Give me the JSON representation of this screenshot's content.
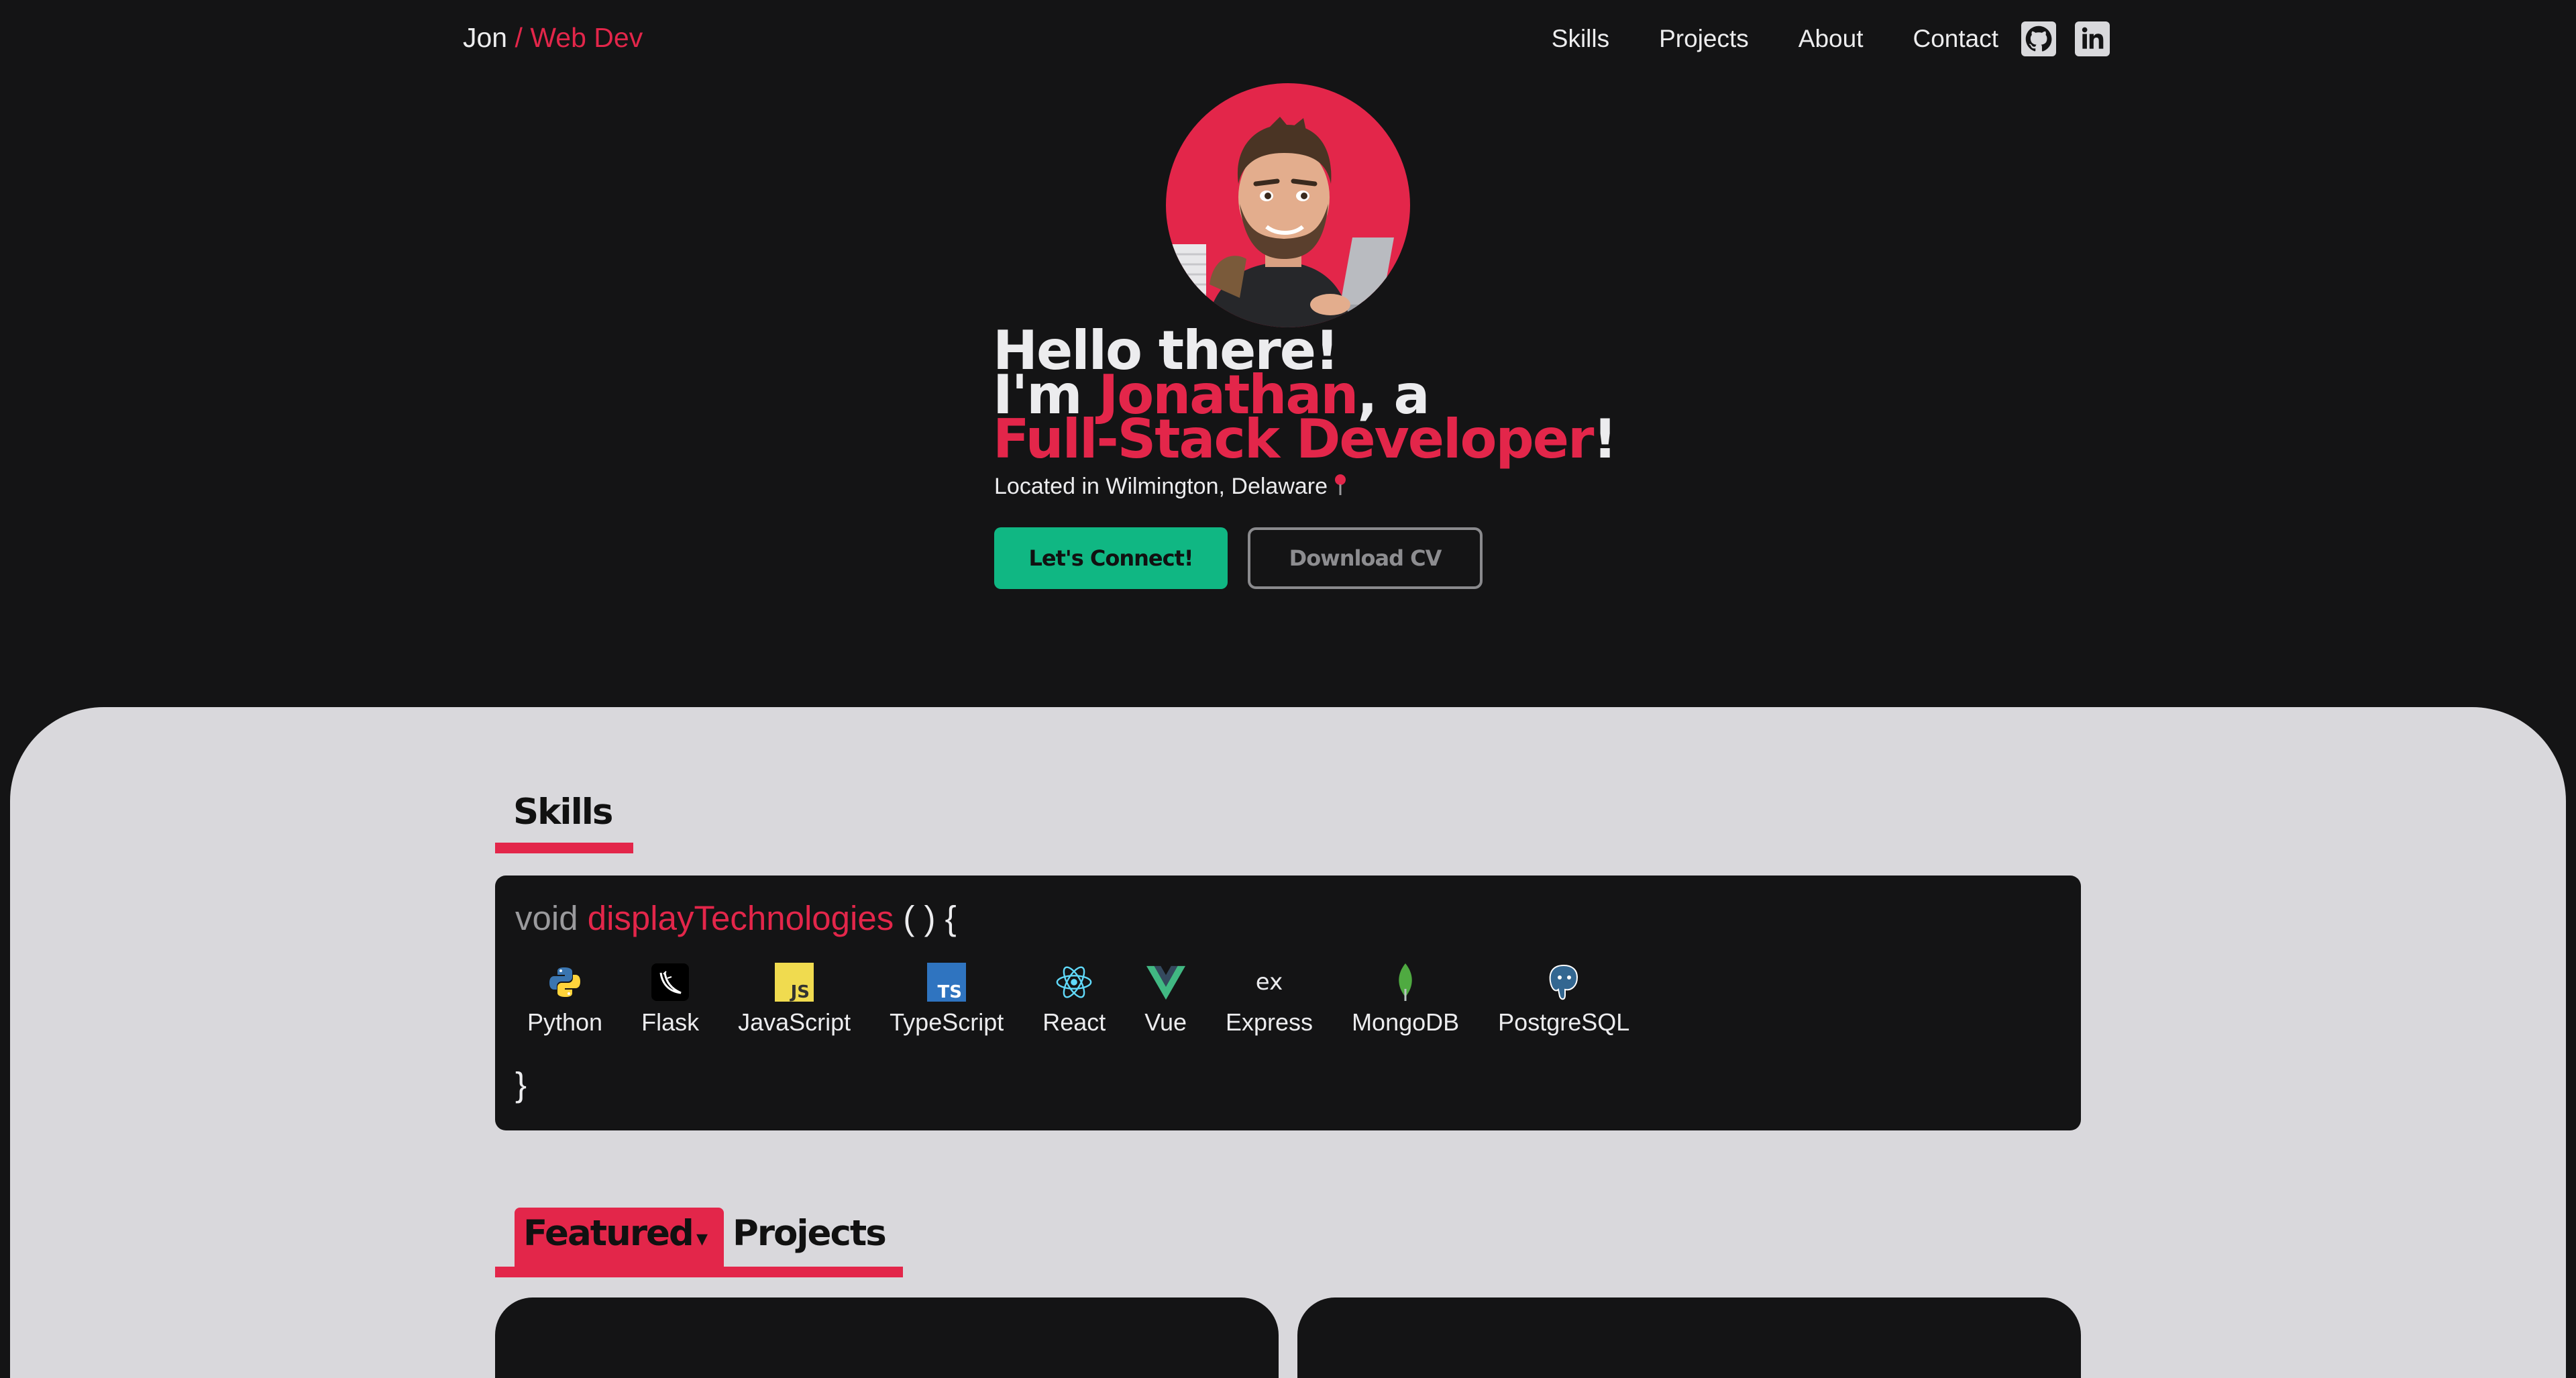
{
  "nav": {
    "brand_name": "Jon",
    "brand_separator": "/",
    "brand_role": "Web Dev",
    "links": [
      "Skills",
      "Projects",
      "About",
      "Contact"
    ],
    "social_icons": [
      "github-icon",
      "linkedin-icon"
    ]
  },
  "hero": {
    "greeting": "Hello there!",
    "intro_prefix": "I'm ",
    "name": "Jonathan",
    "intro_suffix": ", a",
    "role": "Full-Stack Developer",
    "role_suffix": "!",
    "location": "Located in Wilmington, Delaware",
    "location_icon": "pin-icon",
    "connect_label": "Let's Connect!",
    "cv_label": "Download CV"
  },
  "skills": {
    "heading": "Skills",
    "code_keyword": "void",
    "code_function": "displayTechnologies",
    "code_open": "( ) {",
    "code_close": "}",
    "technologies": [
      "Python",
      "Flask",
      "JavaScript",
      "TypeScript",
      "React",
      "Vue",
      "Express",
      "MongoDB",
      "PostgreSQL"
    ]
  },
  "projects": {
    "filter_label": "Featured",
    "filter_caret": "▾",
    "heading": "Projects"
  },
  "colors": {
    "accent": "#e3264a",
    "background_dark": "#141415",
    "background_light": "#d9d8dc",
    "connect_button": "#10b783"
  }
}
